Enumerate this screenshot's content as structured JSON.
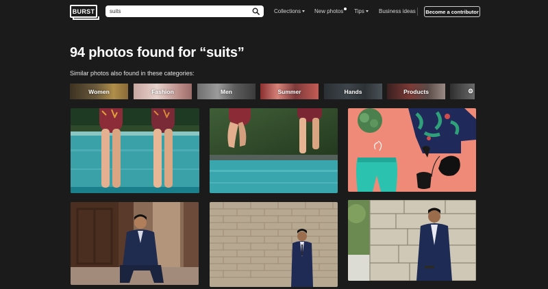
{
  "header": {
    "logo": "BURST",
    "search": {
      "value": "suits",
      "placeholder": ""
    },
    "nav": {
      "collections": "Collections",
      "new_photos": "New photos",
      "tips": "Tips",
      "business_ideas": "Business ideas",
      "contributor": "Become a contributor"
    }
  },
  "results": {
    "heading": "94 photos found for “suits”",
    "similar": "Similar photos also found in these categories:"
  },
  "categories": [
    "Women",
    "Fashion",
    "Men",
    "Summer",
    "Hands",
    "Products"
  ],
  "photos": [
    {
      "subject": "swimsuit-legs-poolside"
    },
    {
      "subject": "swimsuit-jump-pool"
    },
    {
      "subject": "swim-trunks-flatlay"
    },
    {
      "subject": "man-suit-seated"
    },
    {
      "subject": "man-suit-brick-wall"
    },
    {
      "subject": "man-suit-stone-wall"
    }
  ]
}
